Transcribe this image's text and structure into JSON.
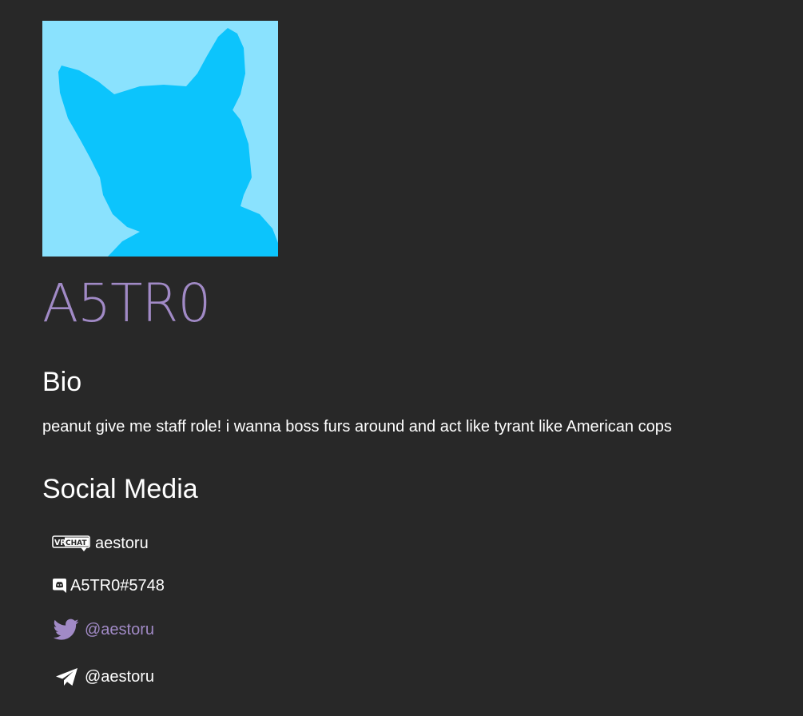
{
  "profile": {
    "name": "A5TR0",
    "avatar_colors": {
      "background": "#8ae2fe",
      "silhouette": "#0cc4fc"
    }
  },
  "bio": {
    "title": "Bio",
    "text": "peanut give me staff role! i wanna boss furs around and act like tyrant like American cops"
  },
  "social": {
    "title": "Social Media",
    "items": [
      {
        "platform": "vrchat",
        "icon": "vrchat-icon",
        "label": "aestoru",
        "icon_text_top": "VR",
        "icon_text_bottom": "CHAT"
      },
      {
        "platform": "discord",
        "icon": "discord-icon",
        "label": "A5TR0#5748"
      },
      {
        "platform": "twitter",
        "icon": "twitter-bird-icon",
        "label": "@aestoru",
        "color": "#a18ac6"
      },
      {
        "platform": "telegram",
        "icon": "telegram-plane-icon",
        "label": "@aestoru"
      }
    ]
  },
  "colors": {
    "background": "#282828",
    "accent": "#a18ac6",
    "text": "#ffffff"
  }
}
